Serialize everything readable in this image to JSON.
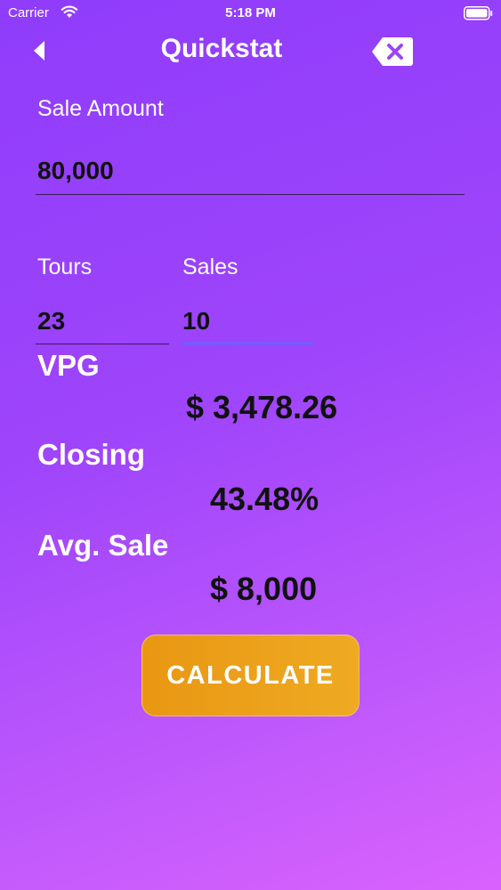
{
  "status_bar": {
    "carrier": "Carrier",
    "time": "5:18 PM",
    "wifi_icon": "wifi-icon",
    "battery_icon": "battery-icon"
  },
  "nav": {
    "title": "Quickstat",
    "back_icon": "back-arrow-icon",
    "clear_icon": "delete-backspace-icon"
  },
  "form": {
    "sale_amount": {
      "label": "Sale Amount",
      "value": "80,000"
    },
    "tours": {
      "label": "Tours",
      "value": "23"
    },
    "sales": {
      "label": "Sales",
      "value": "10"
    }
  },
  "results": {
    "vpg": {
      "label": "VPG",
      "value": "$ 3,478.26"
    },
    "closing": {
      "label": "Closing",
      "value": "43.48%"
    },
    "avg_sale": {
      "label": "Avg. Sale",
      "value": "$ 8,000"
    }
  },
  "actions": {
    "calculate_label": "CALCULATE"
  },
  "colors": {
    "gradient_start": "#8f3cfb",
    "gradient_end": "#d962fd",
    "button": "#eba01a",
    "active_underline": "#3a7bff"
  }
}
